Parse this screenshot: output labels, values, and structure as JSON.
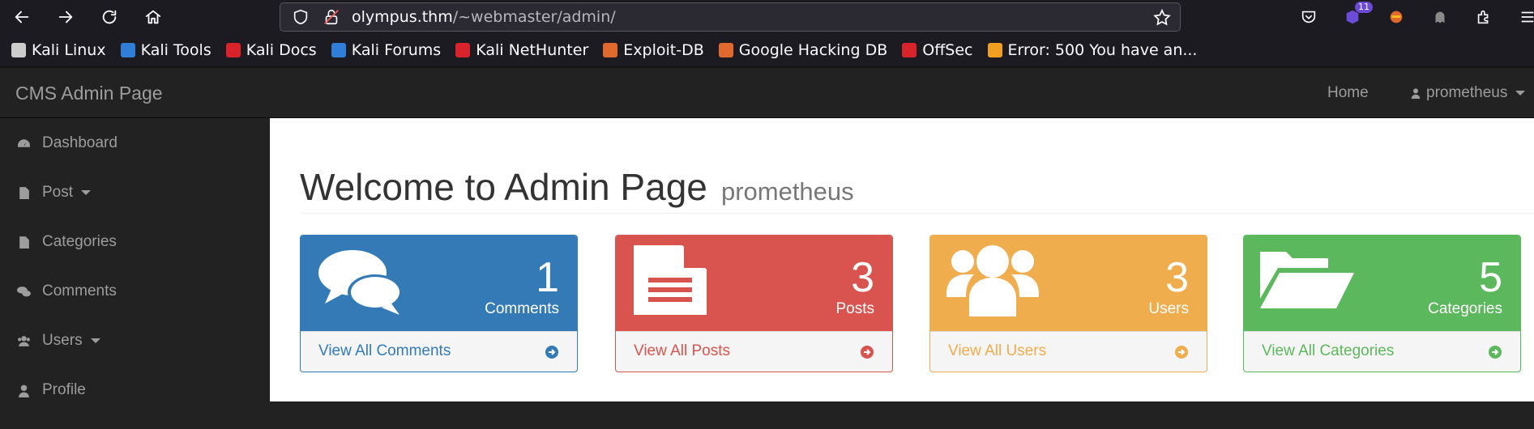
{
  "browser": {
    "url_host": "olympus.thm",
    "url_path": "/~webmaster/admin/",
    "extensions_badge": "11"
  },
  "bookmarks": [
    {
      "label": "Kali Linux",
      "color": "#cccccc"
    },
    {
      "label": "Kali Tools",
      "color": "#2f7fd8"
    },
    {
      "label": "Kali Docs",
      "color": "#d8232a"
    },
    {
      "label": "Kali Forums",
      "color": "#2f7fd8"
    },
    {
      "label": "Kali NetHunter",
      "color": "#d8232a"
    },
    {
      "label": "Exploit-DB",
      "color": "#e0692e"
    },
    {
      "label": "Google Hacking DB",
      "color": "#e0692e"
    },
    {
      "label": "OffSec",
      "color": "#d8232a"
    },
    {
      "label": "Error: 500 You have an...",
      "color": "#f0a020"
    }
  ],
  "navbar": {
    "brand": "CMS Admin Page",
    "home": "Home",
    "user": "prometheus"
  },
  "sidebar": {
    "items": [
      {
        "label": "Dashboard",
        "icon": "dashboard-icon"
      },
      {
        "label": "Post",
        "icon": "file-icon",
        "dropdown": true
      },
      {
        "label": "Categories",
        "icon": "file-icon"
      },
      {
        "label": "Comments",
        "icon": "comments-icon"
      },
      {
        "label": "Users",
        "icon": "users-icon",
        "dropdown": true
      },
      {
        "label": "Profile",
        "icon": "user-icon"
      }
    ]
  },
  "main": {
    "title": "Welcome to Admin Page",
    "subtitle": "prometheus",
    "panels": [
      {
        "count": "1",
        "label": "Comments",
        "link": "View All Comments",
        "color": "#337ab7",
        "icon": "comments-icon"
      },
      {
        "count": "3",
        "label": "Posts",
        "link": "View All Posts",
        "color": "#d9534f",
        "icon": "file-text-icon"
      },
      {
        "count": "3",
        "label": "Users",
        "link": "View All Users",
        "color": "#f0ad4e",
        "icon": "users-icon"
      },
      {
        "count": "5",
        "label": "Categories",
        "link": "View All Categories",
        "color": "#5cb85c",
        "icon": "folder-open-icon"
      }
    ]
  }
}
